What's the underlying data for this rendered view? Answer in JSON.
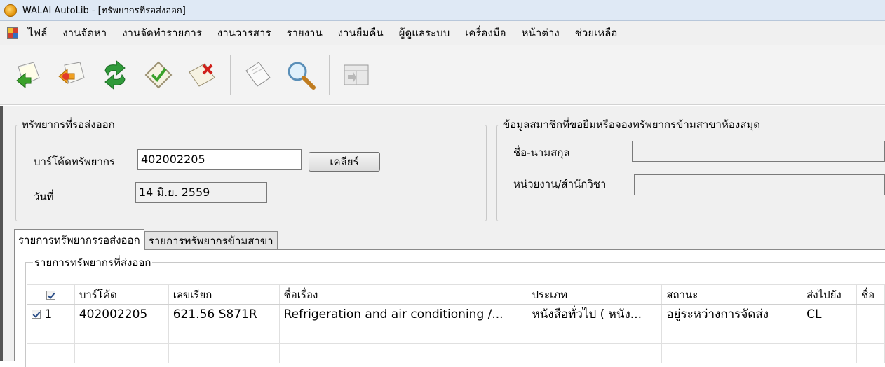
{
  "window": {
    "title": "WALAI AutoLib - [ทรัพยากรที่รอส่งออก]"
  },
  "menu": {
    "items": [
      "ไฟล์",
      "งานจัดหา",
      "งานจัดทำรายการ",
      "งานวารสาร",
      "รายงาน",
      "งานยืมคืน",
      "ผู้ดูแลระบบ",
      "เครื่องมือ",
      "หน้าต่าง",
      "ช่วยเหลือ"
    ]
  },
  "toolbar": {
    "icons": [
      "import-icon",
      "export-icon",
      "refresh-icon",
      "approve-icon",
      "delete-icon",
      "document-icon",
      "search-icon",
      "grid-icon"
    ]
  },
  "resource_group": {
    "title": "ทรัพยากรที่รอส่งออก",
    "barcode_label": "บาร์โค้ดทรัพยากร",
    "barcode_value": "402002205",
    "clear_button": "เคลียร์",
    "date_label": "วันที่",
    "date_value": "14 มิ.ย. 2559"
  },
  "member_group": {
    "title": "ข้อมูลสมาชิกที่ขอยืมหรือจองทรัพยากรข้ามสาขาห้องสมุด",
    "name_label": "ชื่อ-นามสกุล",
    "name_value": "",
    "unit_label": "หน่วยงาน/สำนักวิชา",
    "unit_value": ""
  },
  "tabs": [
    {
      "label": "รายการทรัพยากรรอส่งออก",
      "active": true
    },
    {
      "label": "รายการทรัพยากรข้ามสาขา",
      "active": false
    }
  ],
  "grid": {
    "title": "รายการทรัพยากรที่ส่งออก",
    "columns": [
      "บาร์โค้ด",
      "เลขเรียก",
      "ชื่อเรื่อง",
      "ประเภท",
      "สถานะ",
      "ส่งไปยัง",
      "ชื่อ"
    ],
    "rows": [
      {
        "checked": true,
        "no": "1",
        "barcode": "402002205",
        "call_no": "621.56 S871R",
        "title": "Refrigeration and air conditioning /...",
        "type": "หนังสือทั่วไป ( หนัง...",
        "status": "อยู่ระหว่างการจัดส่ง",
        "send_to": "CL",
        "name": ""
      }
    ]
  }
}
